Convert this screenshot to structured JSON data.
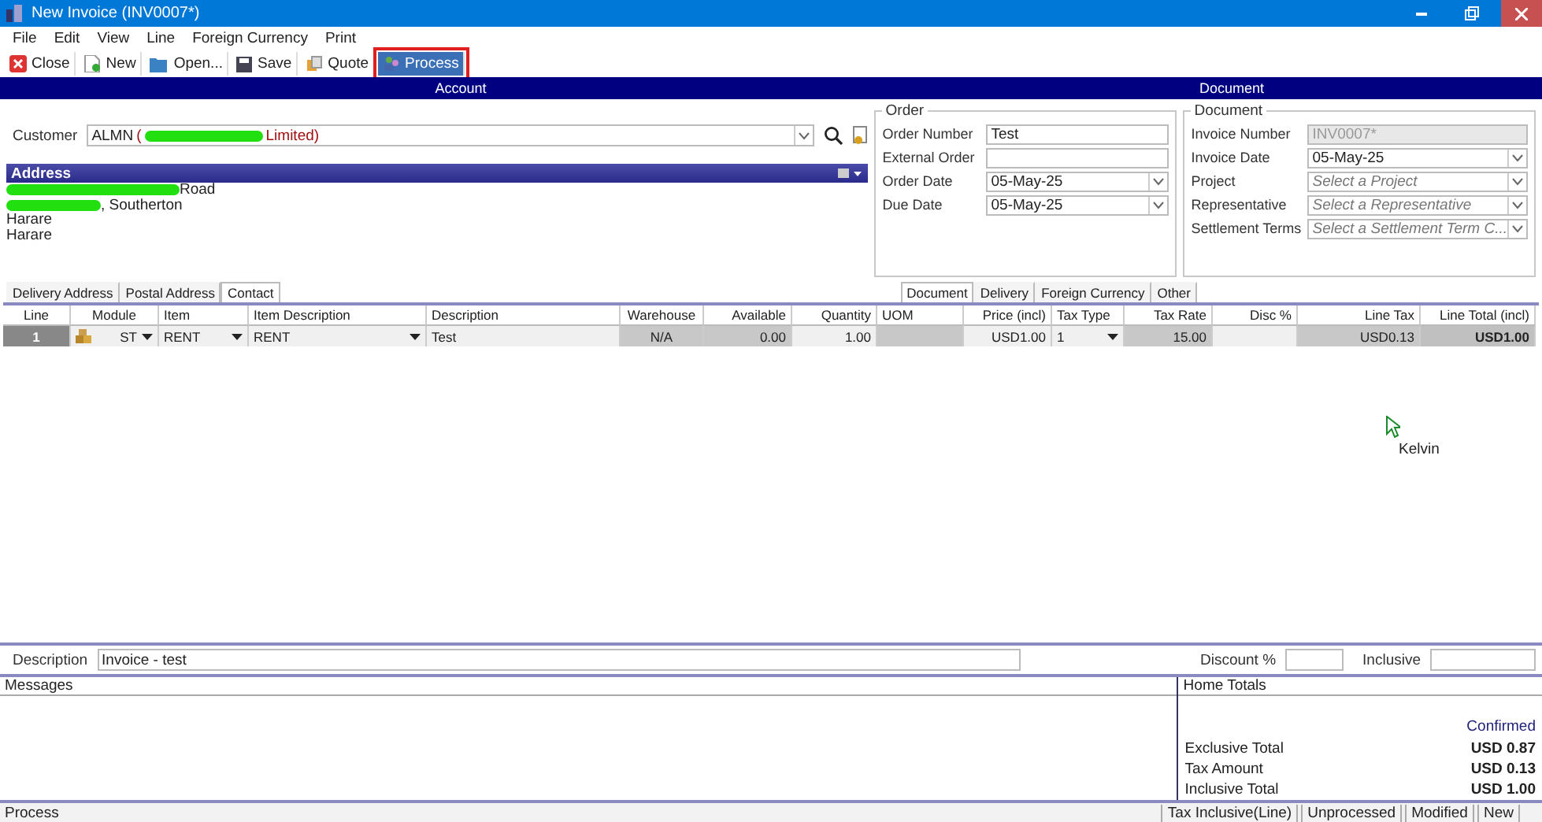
{
  "window": {
    "title": "New Invoice (INV0007*)"
  },
  "menu": [
    "File",
    "Edit",
    "View",
    "Line",
    "Foreign Currency",
    "Print"
  ],
  "toolbar": [
    {
      "label": "Close",
      "selected": false
    },
    {
      "label": "New",
      "selected": false
    },
    {
      "label": "Open...",
      "selected": false
    },
    {
      "label": "Save",
      "selected": false
    },
    {
      "label": "Quote",
      "selected": false
    },
    {
      "label": "Process",
      "selected": true
    }
  ],
  "section_headers": [
    "Account",
    "Document"
  ],
  "customer": {
    "label": "Customer",
    "code": "ALMN",
    "name_start": "(",
    "name_end": "Limited)"
  },
  "address": {
    "title": "Address",
    "lines": [
      {
        "text": "Road",
        "redacted_prefix": true
      },
      {
        "text": ", Southerton",
        "redacted_prefix": true
      },
      {
        "text": "Harare",
        "redacted_prefix": false
      },
      {
        "text": "Harare",
        "redacted_prefix": false
      }
    ]
  },
  "order": {
    "title": "Order",
    "fields": [
      {
        "label": "Order Number",
        "value": "Test",
        "kind": "text"
      },
      {
        "label": "External Order",
        "kind": "text"
      },
      {
        "label": "Order Date",
        "value": "05-May-25",
        "kind": "date"
      },
      {
        "label": "Due Date",
        "value": "05-May-25",
        "kind": "date"
      }
    ]
  },
  "document": {
    "title": "Document",
    "fields": [
      {
        "label": "Invoice Number",
        "value": "INV0007*",
        "kind": "readonly"
      },
      {
        "label": "Invoice Date",
        "value": "05-May-25",
        "kind": "date"
      },
      {
        "label": "Project",
        "placeholder": "Select a Project",
        "kind": "select"
      },
      {
        "label": "Representative",
        "placeholder": "Select a Representative",
        "kind": "select"
      },
      {
        "label": "Settlement Terms",
        "placeholder": "Select a Settlement Term C...",
        "kind": "select"
      }
    ]
  },
  "address_tabs": [
    {
      "label": "Delivery Address",
      "selected": false
    },
    {
      "label": "Postal Address",
      "selected": false
    },
    {
      "label": "Contact",
      "selected": true
    }
  ],
  "document_tabs": [
    {
      "label": "Document",
      "selected": true
    },
    {
      "label": "Delivery",
      "selected": false
    },
    {
      "label": "Foreign Currency",
      "selected": false
    },
    {
      "label": "Other",
      "selected": false
    }
  ],
  "table": {
    "columns": [
      "Line",
      "Module",
      "Item",
      "Item Description",
      "Description",
      "Warehouse",
      "Available",
      "Quantity",
      "UOM",
      "Price (incl)",
      "Tax Type",
      "Tax Rate",
      "Disc %",
      "Line Tax",
      "Line Total (incl)"
    ],
    "rows": [
      {
        "cells": [
          {
            "text": "1",
            "kind": "line"
          },
          {
            "text": "ST",
            "kind": "module"
          },
          {
            "text": "RENT",
            "kind": "dropdown"
          },
          {
            "text": "RENT",
            "kind": "dropdown"
          },
          {
            "text": "Test",
            "kind": "edit"
          },
          {
            "text": "N/A",
            "kind": "readonly"
          },
          {
            "text": "0.00",
            "kind": "readonly"
          },
          {
            "text": "1.00",
            "kind": "edit"
          },
          {
            "kind": "readonly"
          },
          {
            "text": "USD1.00",
            "kind": "edit"
          },
          {
            "text": "1",
            "kind": "dropdown"
          },
          {
            "text": "15.00",
            "kind": "readonly"
          },
          {
            "kind": "edit"
          },
          {
            "text": "USD0.13",
            "kind": "readonly"
          },
          {
            "text": "USD1.00",
            "kind": "total"
          }
        ]
      }
    ]
  },
  "pointer": {
    "label": "Kelvin"
  },
  "description": {
    "label": "Description",
    "value": "Invoice - test"
  },
  "discount": {
    "label": "Discount %"
  },
  "inclusive": {
    "label": "Inclusive"
  },
  "messages": {
    "title": "Messages"
  },
  "home_totals": {
    "title": "Home Totals",
    "status": "Confirmed",
    "lines": [
      {
        "label": "Exclusive Total",
        "value": "USD 0.87"
      },
      {
        "label": "Tax Amount",
        "value": "USD 0.13"
      },
      {
        "label": "Inclusive Total",
        "value": "USD 1.00"
      }
    ]
  },
  "status_bar": {
    "text": "Process",
    "panels": [
      "Tax Inclusive(Line)",
      "Unprocessed",
      "Modified",
      "New"
    ]
  }
}
